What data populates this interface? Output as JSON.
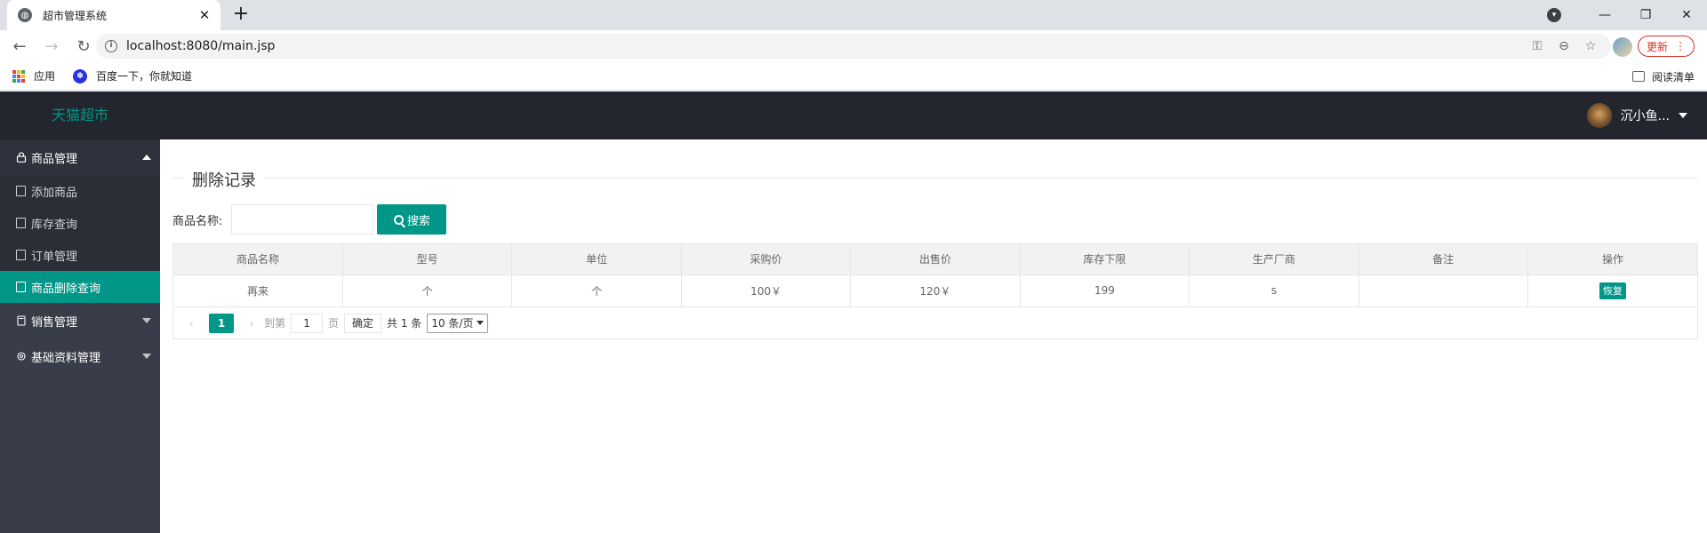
{
  "browser": {
    "tab_title": "超市管理系统",
    "tab_close": "✕",
    "new_tab": "+",
    "url": "localhost:8080/main.jsp",
    "update_label": "更新",
    "update_menu": "⋮",
    "win_minimize": "—",
    "win_restore": "❐",
    "win_close": "✕",
    "back": "←",
    "forward": "→",
    "reload": "↻"
  },
  "bookmarks": {
    "apps_label": "应用",
    "baidu_label": "百度一下，你就知道",
    "reading_list_label": "阅读清单"
  },
  "header": {
    "logo": "天猫超市",
    "user_name": "沉小鱼..."
  },
  "sidebar": {
    "groups": [
      {
        "label": "商品管理",
        "open": true,
        "items": [
          {
            "label": "添加商品",
            "active": false
          },
          {
            "label": "库存查询",
            "active": false
          },
          {
            "label": "订单管理",
            "active": false
          },
          {
            "label": "商品删除查询",
            "active": true
          }
        ]
      },
      {
        "label": "销售管理",
        "open": false
      },
      {
        "label": "基础资料管理",
        "open": false
      }
    ]
  },
  "main": {
    "legend": "删除记录",
    "search_label": "商品名称:",
    "search_value": "",
    "search_button": "搜索",
    "table": {
      "headers": [
        "商品名称",
        "型号",
        "单位",
        "采购价",
        "出售价",
        "库存下限",
        "生产厂商",
        "备注",
        "操作"
      ],
      "rows": [
        {
          "name": "再来",
          "model": "个",
          "unit": "个",
          "purchase_price": "100￥",
          "sale_price": "120￥",
          "stock_min": "199",
          "maker": "s",
          "note": "",
          "action": "恢复"
        }
      ]
    },
    "pager": {
      "prev": "‹",
      "current_page": "1",
      "next": "›",
      "goto_label": "到第",
      "goto_value": "1",
      "page_unit": "页",
      "confirm": "确定",
      "total": "共 1 条",
      "page_size": "10 条/页"
    }
  },
  "colors": {
    "accent": "#009688",
    "header_bg": "#23262e",
    "sidebar_bg": "#393d49",
    "update_red": "#d93025"
  }
}
